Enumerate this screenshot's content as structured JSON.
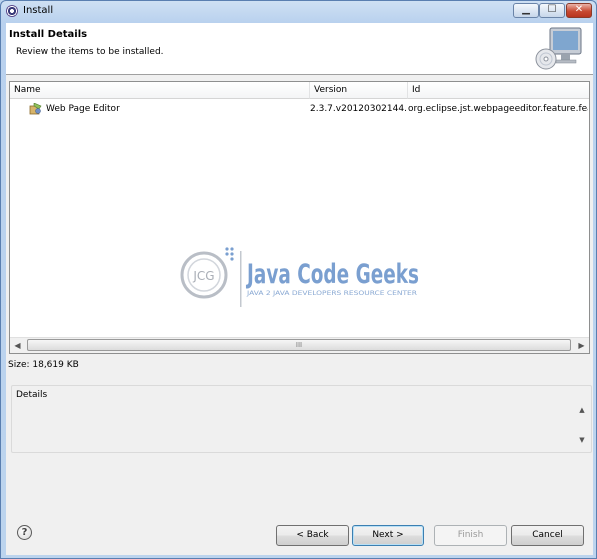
{
  "window": {
    "title": "Install"
  },
  "title_controls": {
    "minimize": "▁",
    "maximize": "☐",
    "close": "✕"
  },
  "header": {
    "title": "Install Details",
    "description": "Review the items to be installed."
  },
  "table": {
    "columns": [
      "Name",
      "Version",
      "Id"
    ],
    "rows": [
      {
        "name": "Web Page Editor",
        "version": "2.3.7.v20120302144...",
        "id": "org.eclipse.jst.webpageeditor.feature.feat..."
      }
    ],
    "scroll_grip": "III"
  },
  "size": {
    "label": "Size: 18,619 KB"
  },
  "details": {
    "label": "Details"
  },
  "buttons": {
    "help": "?",
    "back": "< Back",
    "next": "Next >",
    "finish": "Finish",
    "cancel": "Cancel"
  },
  "watermark": {
    "title": "Java Code Geeks",
    "subtitle": "JAVA 2 JAVA DEVELOPERS RESOURCE CENTER",
    "badge": "JCG"
  },
  "colors": {
    "watermark_blue": "#7a9fd0",
    "title_bar": "#bcd4ee",
    "default_button_border": "#3c7fb1"
  }
}
